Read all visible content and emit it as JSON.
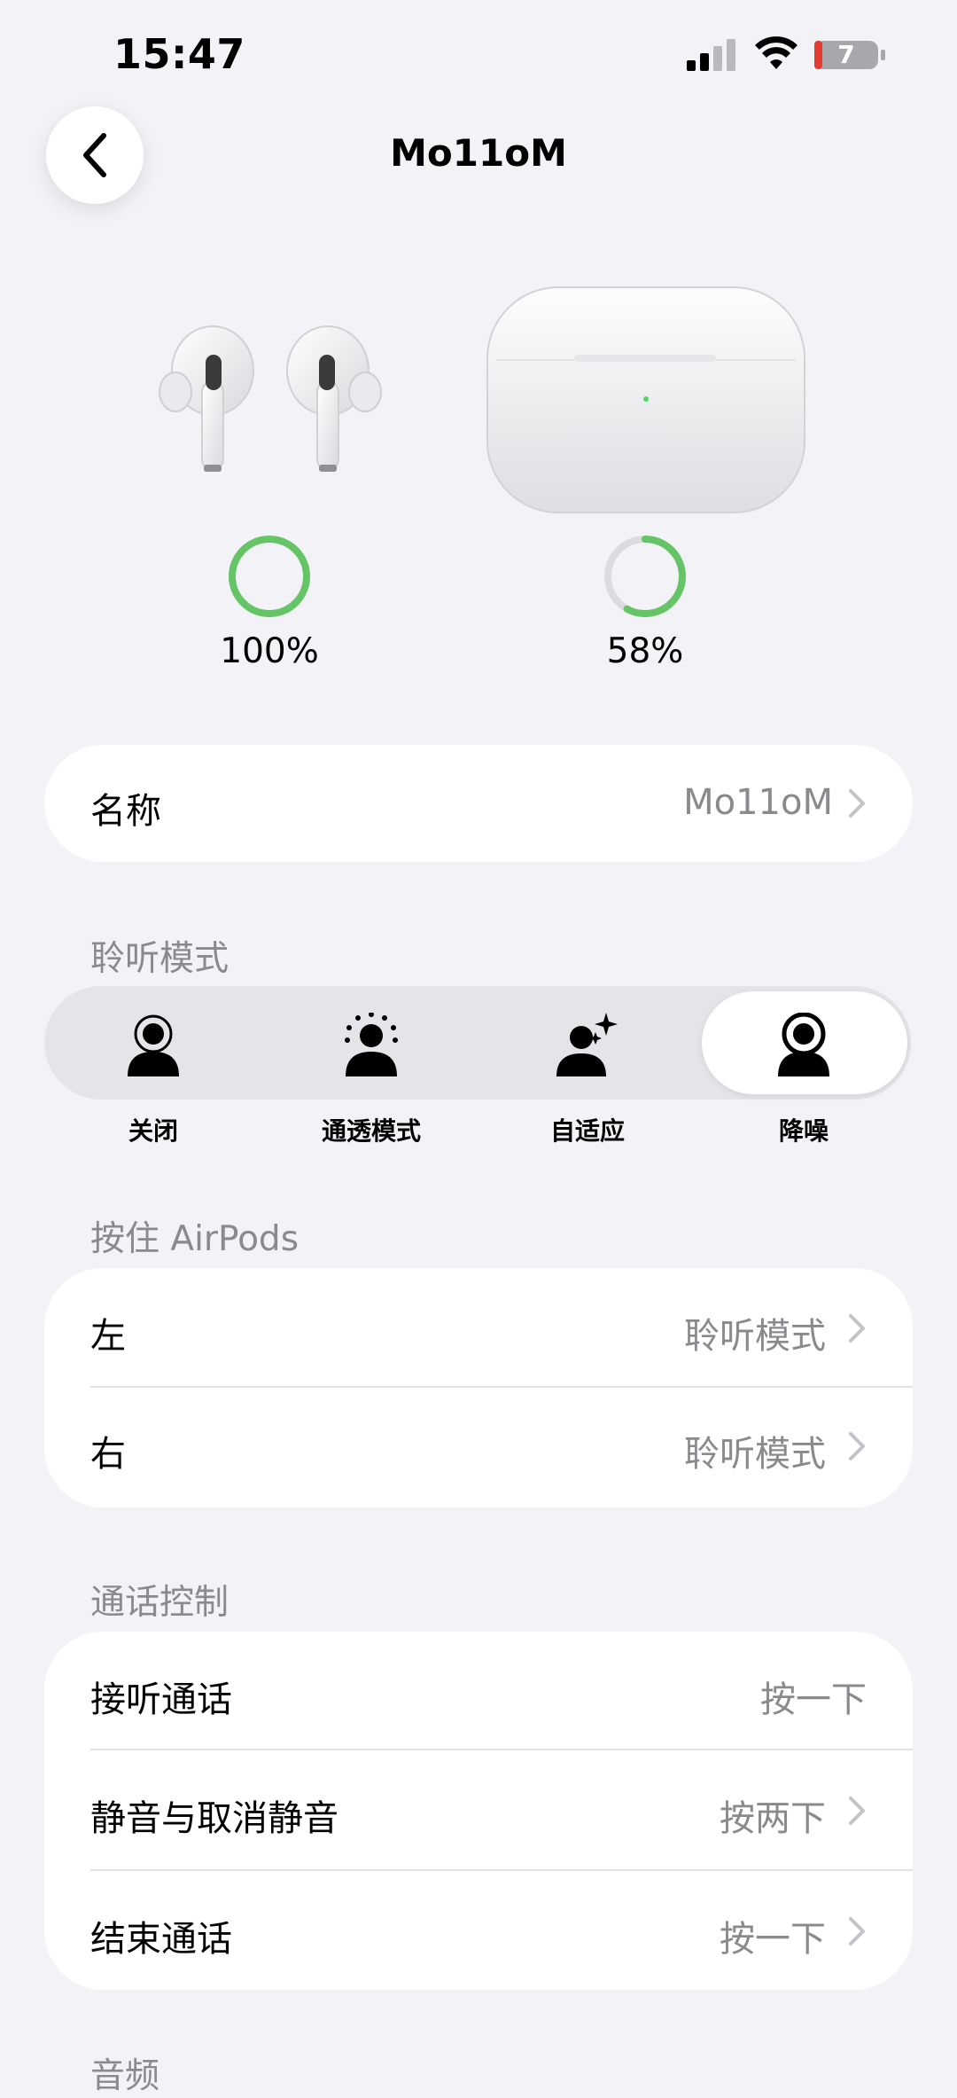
{
  "status_bar": {
    "time": "15:47",
    "battery": "7"
  },
  "nav": {
    "title": "Mo11oM"
  },
  "battery": {
    "earbuds_percent_label": "100%",
    "earbuds_level": 1.0,
    "case_percent_label": "58%",
    "case_level": 0.58
  },
  "name_row": {
    "label": "名称",
    "value": "Mo11oM"
  },
  "listening_mode": {
    "header": "聆听模式",
    "options": [
      {
        "label": "关闭",
        "icon": "person-off-icon"
      },
      {
        "label": "通透模式",
        "icon": "person-transparency-icon"
      },
      {
        "label": "自适应",
        "icon": "person-sparkle-icon"
      },
      {
        "label": "降噪",
        "icon": "person-noise-cancel-icon"
      }
    ],
    "selected": "降噪"
  },
  "press_hold": {
    "header": "按住 AirPods",
    "rows": [
      {
        "label": "左",
        "value": "聆听模式"
      },
      {
        "label": "右",
        "value": "聆听模式"
      }
    ]
  },
  "call_controls": {
    "header": "通话控制",
    "rows": [
      {
        "label": "接听通话",
        "value": "按一下"
      },
      {
        "label": "静音与取消静音",
        "value": "按两下"
      },
      {
        "label": "结束通话",
        "value": "按一下"
      }
    ]
  },
  "next_section_header": "音频",
  "colors": {
    "battery_green": "#65c466",
    "background": "#f2f2f7",
    "secondary_text": "#8a8a8e"
  }
}
